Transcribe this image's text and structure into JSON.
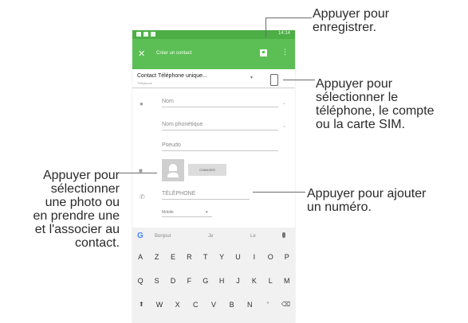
{
  "callouts": {
    "save": [
      "Appuyer pour",
      "enregistrer."
    ],
    "select_account": [
      "Appuyer pour",
      "sélectionner le",
      "téléphone, le compte",
      "ou la carte SIM."
    ],
    "photo": [
      "Appuyer pour",
      "sélectionner",
      "une photo ou",
      "en prendre une",
      "et l'associer au",
      "contact."
    ],
    "add_number": [
      "Appuyer pour ajouter",
      "un numéro."
    ]
  },
  "phone": {
    "status_time": "14:14",
    "toolbar": {
      "close_icon": "close-icon",
      "title": "Créer un contact",
      "save_icon": "save-icon",
      "menu_icon": "more-vert-icon"
    },
    "account": {
      "title": "Contact Téléphone unique...",
      "subtitle": "Téléphone"
    },
    "fields": {
      "name": "Nom",
      "phonetic_name": "Nom phonétique",
      "nickname": "Pseudo",
      "change_photo": "CHANGER",
      "phone": "TÉLÉPHONE",
      "phone_type": "Mobile"
    },
    "keyboard": {
      "suggestions": [
        "Bonjour",
        "Je",
        "Le"
      ],
      "row1": [
        "A",
        "Z",
        "E",
        "R",
        "T",
        "Y",
        "U",
        "I",
        "O",
        "P"
      ],
      "row2": [
        "Q",
        "S",
        "D",
        "F",
        "G",
        "H",
        "J",
        "K",
        "L",
        "M"
      ],
      "row3": [
        "W",
        "X",
        "C",
        "V",
        "B",
        "N"
      ]
    }
  },
  "colors": {
    "toolbar": "#5cbf55",
    "statusbar": "#4cae45"
  }
}
